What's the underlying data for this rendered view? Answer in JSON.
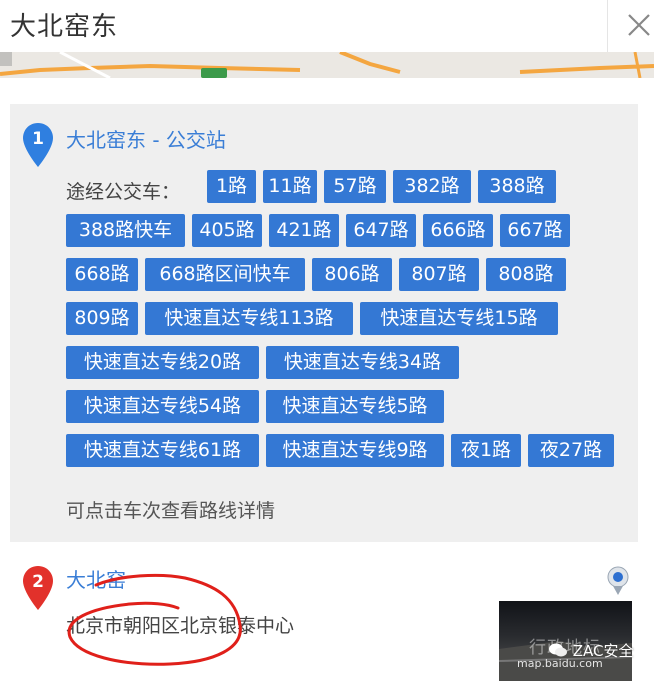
{
  "search": {
    "query": "大北窑东"
  },
  "result1": {
    "marker_number": "1",
    "title": "大北窑东 - 公交站",
    "routes_label": "途经公交车：",
    "routes": [
      "1路",
      "11路",
      "57路",
      "382路",
      "388路",
      "388路快车",
      "405路",
      "421路",
      "647路",
      "666路",
      "667路",
      "668路",
      "668路区间快车",
      "806路",
      "807路",
      "808路",
      "809路",
      "快速直达专线113路",
      "快速直达专线15路",
      "快速直达专线20路",
      "快速直达专线34路",
      "快速直达专线54路",
      "快速直达专线5路",
      "快速直达专线61路",
      "快速直达专线9路",
      "夜1路",
      "夜27路"
    ],
    "hint": "可点击车次查看路线详情"
  },
  "result2": {
    "marker_number": "2",
    "title": "大北窑",
    "address": "北京市朝阳区北京银泰中心"
  },
  "thumbnail": {
    "caption": "行政地标",
    "source": "map.baidu.com"
  },
  "watermark": "ZAC安全",
  "colors": {
    "route_chip": "#3478d4",
    "link": "#3a7ed6",
    "marker": "#2f7fe0",
    "marker2": "#e2312b",
    "card_bg": "#efefef"
  },
  "icons": [
    "close-icon",
    "map-marker-icon",
    "location-pin-icon",
    "wechat-icon"
  ]
}
